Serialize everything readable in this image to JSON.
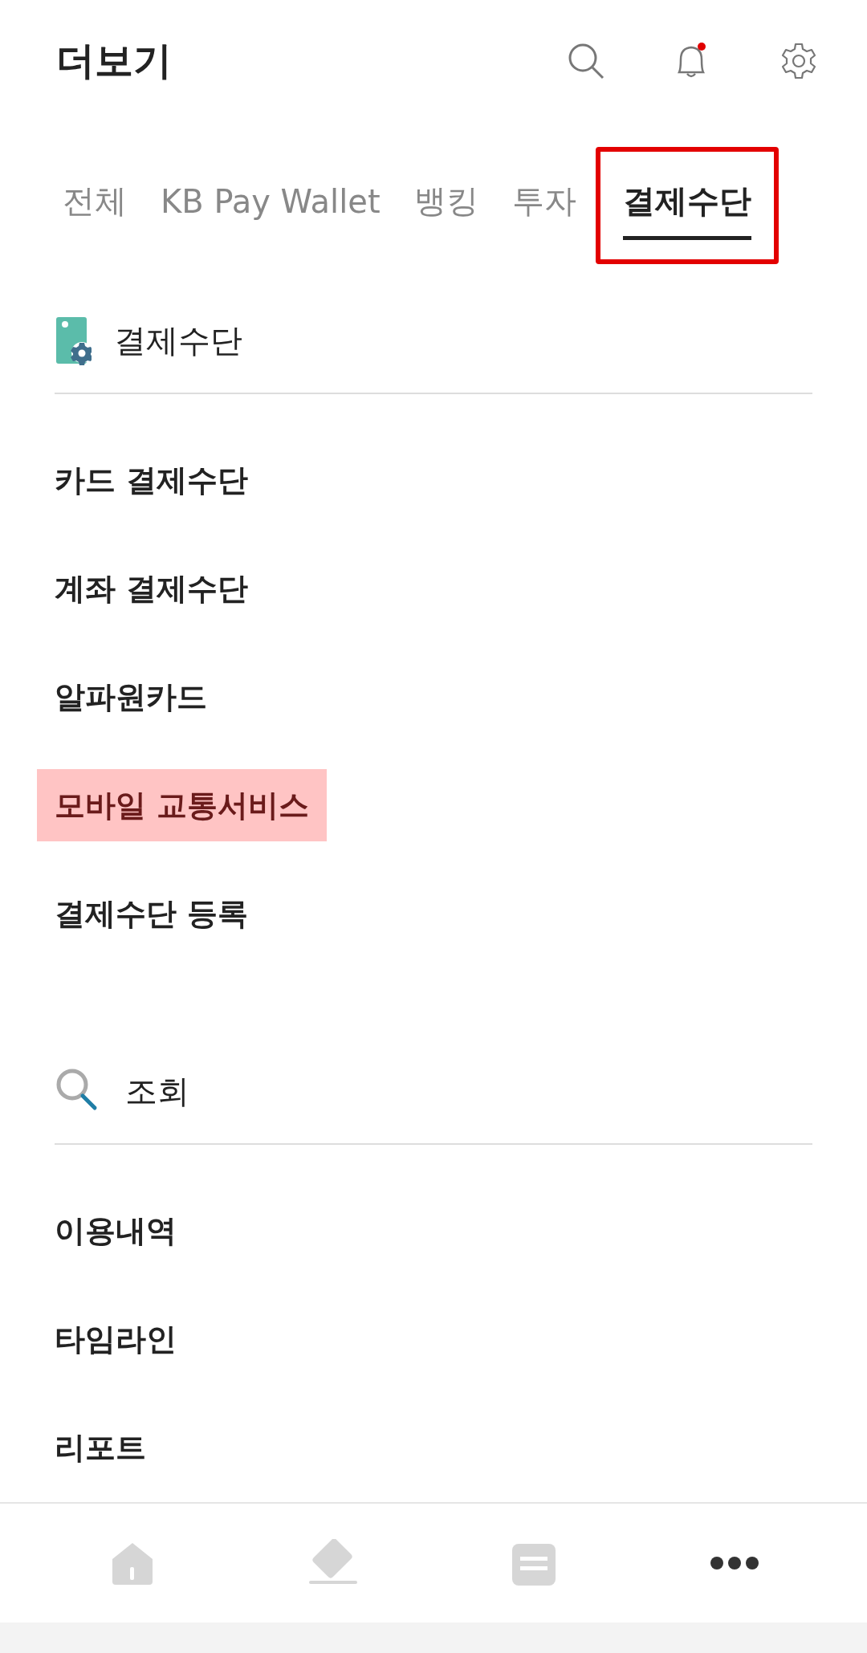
{
  "header": {
    "title": "더보기",
    "notification_dot": true
  },
  "tabs": [
    {
      "label": "전체",
      "selected": false,
      "outlined": false
    },
    {
      "label": "KB Pay Wallet",
      "selected": false,
      "outlined": false
    },
    {
      "label": "뱅킹",
      "selected": false,
      "outlined": false
    },
    {
      "label": "투자",
      "selected": false,
      "outlined": false
    },
    {
      "label": "결제수단",
      "selected": true,
      "outlined": true
    }
  ],
  "sections": [
    {
      "title": "결제수단",
      "kind": "card",
      "items": [
        {
          "label": "카드 결제수단",
          "highlighted": false
        },
        {
          "label": "계좌 결제수단",
          "highlighted": false
        },
        {
          "label": "알파원카드",
          "highlighted": false
        },
        {
          "label": "모바일 교통서비스",
          "highlighted": true
        },
        {
          "label": "결제수단 등록",
          "highlighted": false
        }
      ]
    },
    {
      "title": "조회",
      "kind": "search",
      "items": [
        {
          "label": "이용내역",
          "highlighted": false
        },
        {
          "label": "타임라인",
          "highlighted": false
        },
        {
          "label": "리포트",
          "highlighted": false
        }
      ]
    }
  ],
  "bottom_nav": [
    {
      "kind": "home",
      "selected": false
    },
    {
      "kind": "card",
      "selected": false
    },
    {
      "kind": "wallet",
      "selected": false
    },
    {
      "kind": "more",
      "selected": true
    }
  ]
}
